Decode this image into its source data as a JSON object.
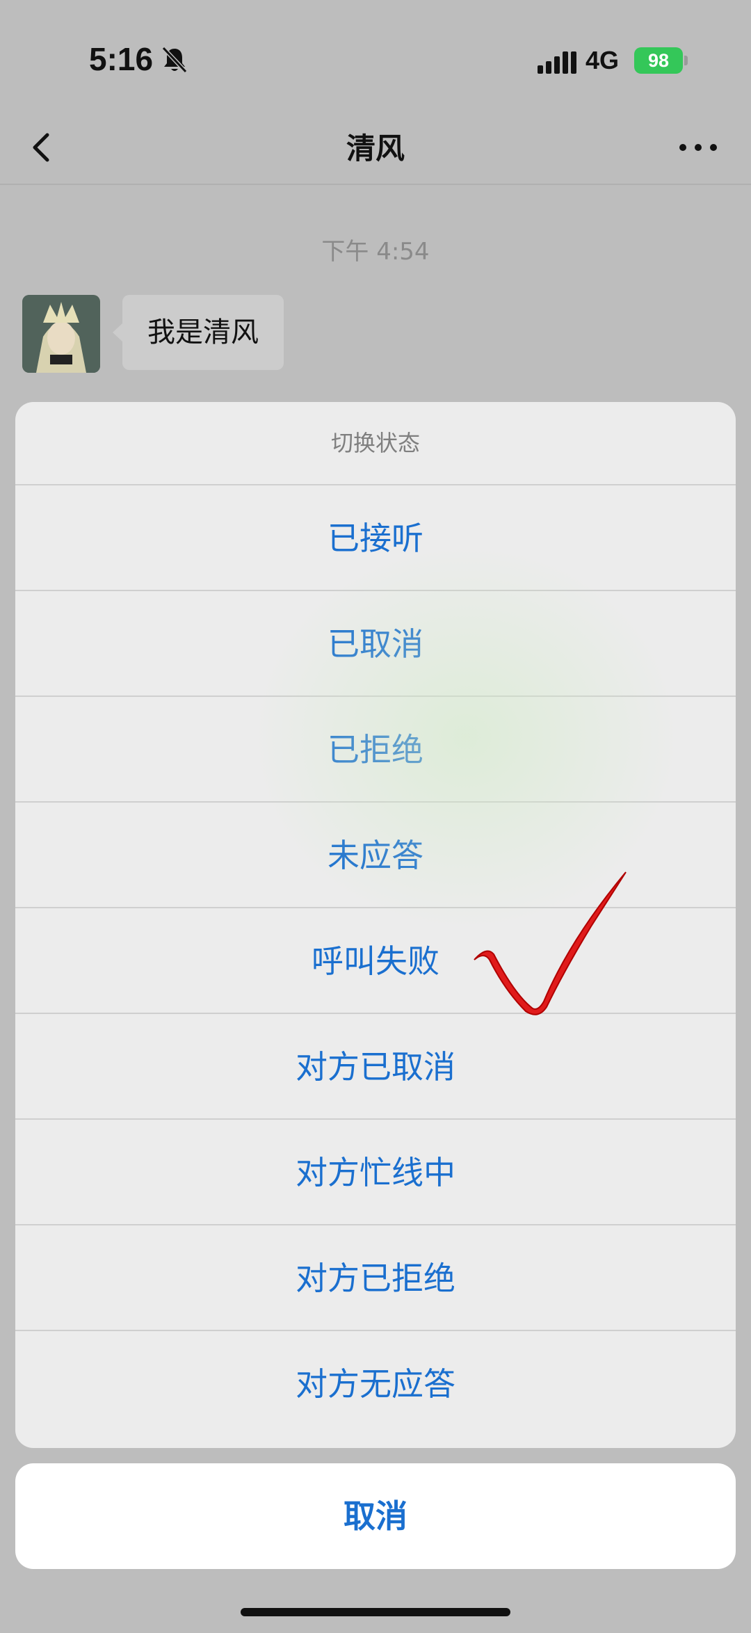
{
  "status_bar": {
    "time": "5:16",
    "network": "4G",
    "battery": "98"
  },
  "nav": {
    "title": "清风"
  },
  "chat": {
    "timestamp": "下午 4:54",
    "messages": [
      {
        "text": "我是清风"
      }
    ]
  },
  "action_sheet": {
    "title": "切换状态",
    "options": [
      {
        "label": "已接听"
      },
      {
        "label": "已取消"
      },
      {
        "label": "已拒绝"
      },
      {
        "label": "未应答"
      },
      {
        "label": "呼叫失败"
      },
      {
        "label": "对方已取消"
      },
      {
        "label": "对方忙线中"
      },
      {
        "label": "对方已拒绝"
      },
      {
        "label": "对方无应答"
      }
    ],
    "cancel_label": "取消"
  },
  "colors": {
    "accent": "#1a6fcf",
    "battery": "#34c759",
    "check": "#e02020"
  },
  "icons": [
    "bell-off-icon",
    "signal-icon",
    "back-icon",
    "more-icon",
    "check-mark-icon"
  ]
}
